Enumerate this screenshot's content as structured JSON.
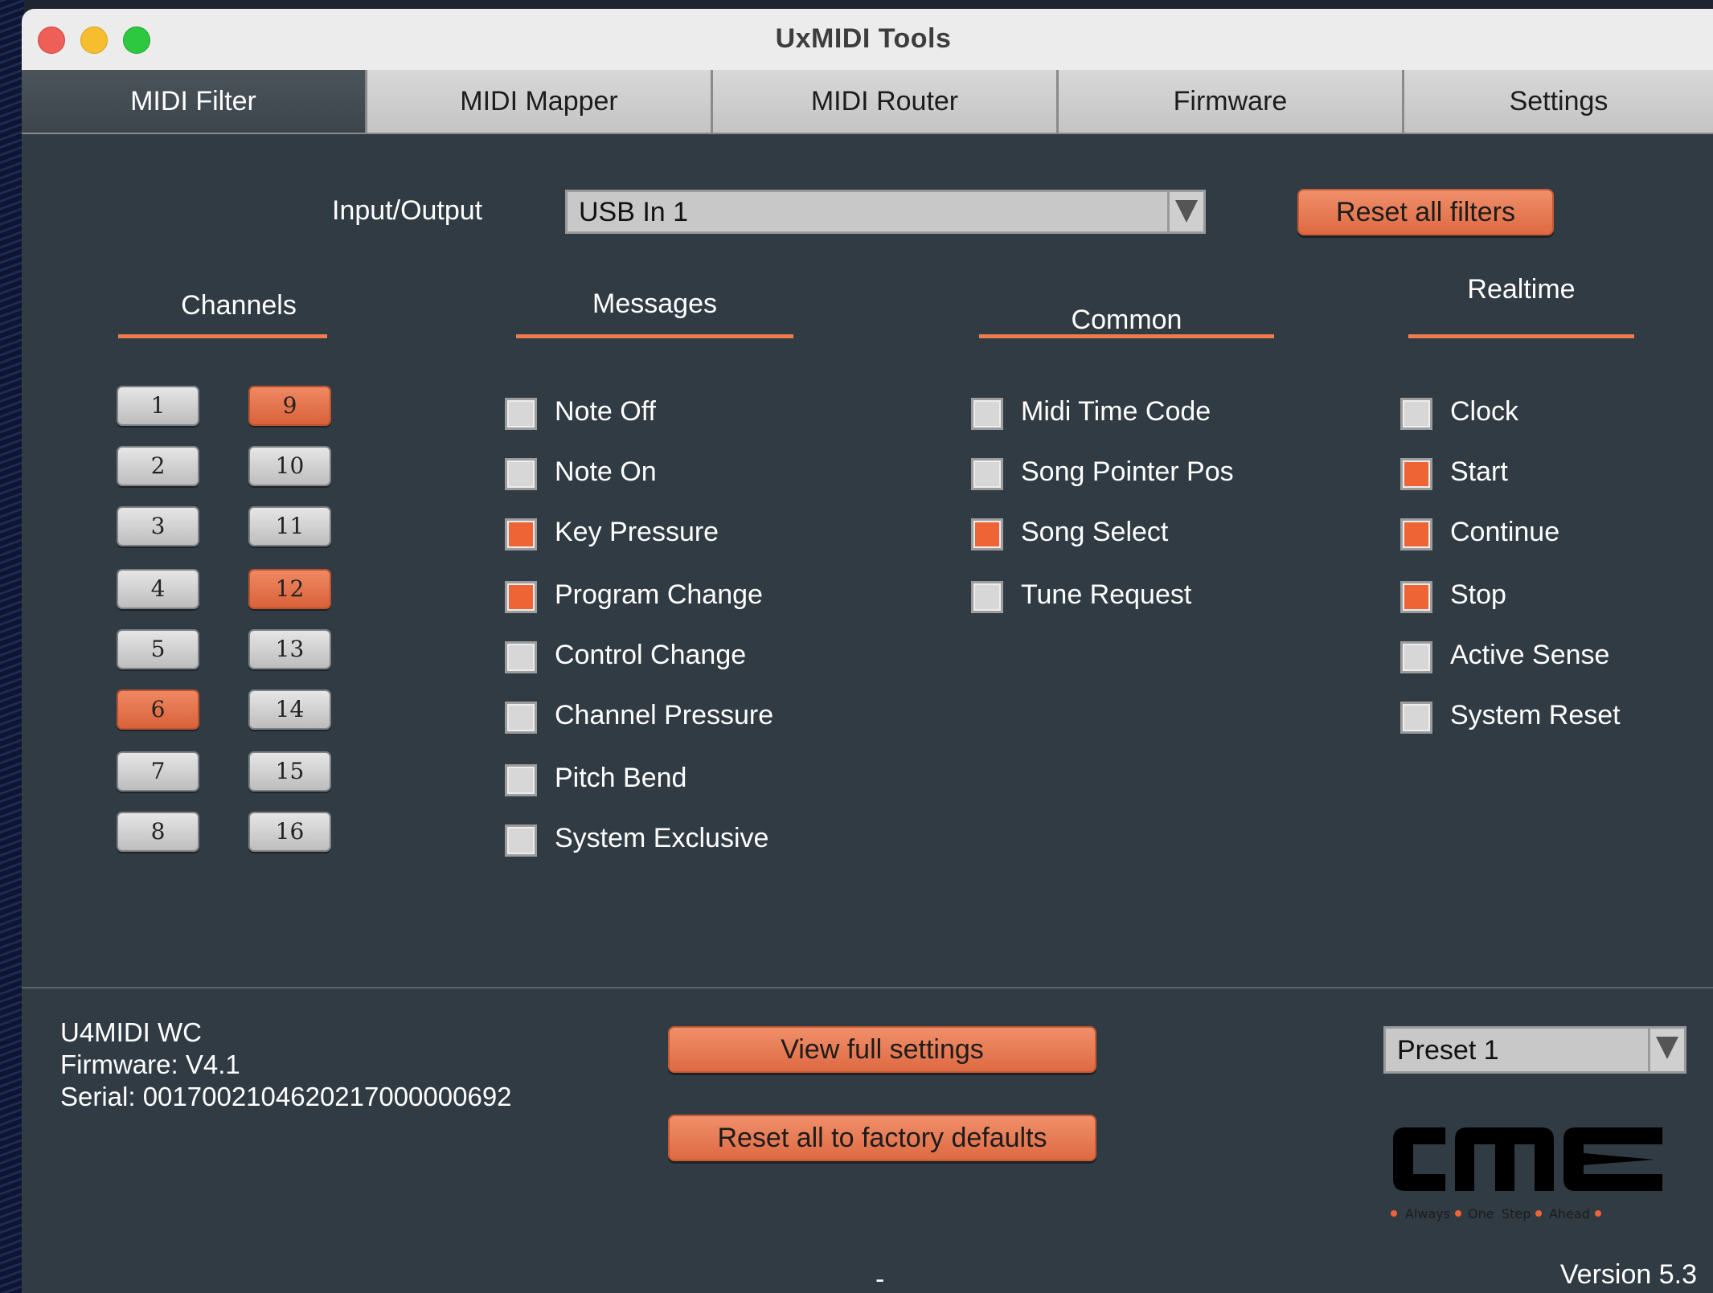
{
  "window": {
    "title": "UxMIDI Tools"
  },
  "tabs": [
    {
      "label": "MIDI Filter",
      "active": true
    },
    {
      "label": "MIDI Mapper",
      "active": false
    },
    {
      "label": "MIDI Router",
      "active": false
    },
    {
      "label": "Firmware",
      "active": false
    },
    {
      "label": "Settings",
      "active": false
    }
  ],
  "io": {
    "label": "Input/Output",
    "value": "USB In 1"
  },
  "buttons": {
    "reset_filters": "Reset all filters",
    "view_settings": "View full settings",
    "reset_factory": "Reset all to factory defaults"
  },
  "sections": {
    "channels": "Channels",
    "messages": "Messages",
    "common": "Common",
    "realtime": "Realtime"
  },
  "channels": [
    {
      "label": "1",
      "on": false
    },
    {
      "label": "2",
      "on": false
    },
    {
      "label": "3",
      "on": false
    },
    {
      "label": "4",
      "on": false
    },
    {
      "label": "5",
      "on": false
    },
    {
      "label": "6",
      "on": true
    },
    {
      "label": "7",
      "on": false
    },
    {
      "label": "8",
      "on": false
    },
    {
      "label": "9",
      "on": true
    },
    {
      "label": "10",
      "on": false
    },
    {
      "label": "11",
      "on": false
    },
    {
      "label": "12",
      "on": true
    },
    {
      "label": "13",
      "on": false
    },
    {
      "label": "14",
      "on": false
    },
    {
      "label": "15",
      "on": false
    },
    {
      "label": "16",
      "on": false
    }
  ],
  "messages": [
    {
      "label": "Note Off",
      "checked": false
    },
    {
      "label": "Note On",
      "checked": false
    },
    {
      "label": "Key Pressure",
      "checked": true
    },
    {
      "label": "Program Change",
      "checked": true
    },
    {
      "label": "Control Change",
      "checked": false
    },
    {
      "label": "Channel Pressure",
      "checked": false
    },
    {
      "label": "Pitch Bend",
      "checked": false
    },
    {
      "label": "System Exclusive",
      "checked": false
    }
  ],
  "common": [
    {
      "label": "Midi Time Code",
      "checked": false
    },
    {
      "label": "Song Pointer Pos",
      "checked": false
    },
    {
      "label": "Song Select",
      "checked": true
    },
    {
      "label": "Tune Request",
      "checked": false
    }
  ],
  "realtime": [
    {
      "label": "Clock",
      "checked": false
    },
    {
      "label": "Start",
      "checked": true
    },
    {
      "label": "Continue",
      "checked": true
    },
    {
      "label": "Stop",
      "checked": true
    },
    {
      "label": "Active Sense",
      "checked": false
    },
    {
      "label": "System Reset",
      "checked": false
    }
  ],
  "device": {
    "name": "U4MIDI WC",
    "firmware": "Firmware: V4.1",
    "serial": "Serial: 0017002104620217000000692"
  },
  "preset": {
    "value": "Preset 1"
  },
  "logo": {
    "text": "CME",
    "tagline": "Always One Step Ahead"
  },
  "status": {
    "dash": "-",
    "version": "Version 5.3"
  },
  "colors": {
    "accent": "#ef6434",
    "background": "#303b43"
  }
}
